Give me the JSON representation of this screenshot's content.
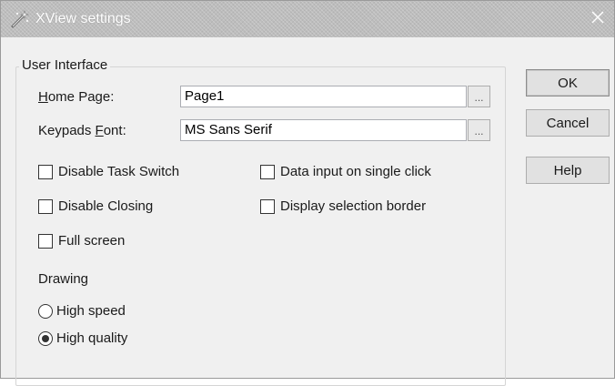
{
  "window": {
    "title": "XView settings",
    "app_icon": "settings-wand-icon",
    "close_icon": "close-icon"
  },
  "group": {
    "legend": "User Interface"
  },
  "home_page": {
    "label_mnemonic": "H",
    "label_rest": "ome Page:",
    "value": "Page1",
    "browse_label": "..."
  },
  "keypads_font": {
    "label_start": "Keypads ",
    "label_mnemonic": "F",
    "label_end": "ont:",
    "value": "MS Sans Serif",
    "browse_label": "..."
  },
  "checkboxes": {
    "disable_task_switch": {
      "label": "Disable Task Switch",
      "checked": false
    },
    "disable_closing": {
      "label": "Disable Closing",
      "checked": false
    },
    "full_screen": {
      "label": "Full screen",
      "checked": false
    },
    "data_input_single_click": {
      "label": "Data input on single click",
      "checked": false
    },
    "display_selection_border": {
      "label": "Display selection border",
      "checked": false
    }
  },
  "drawing": {
    "label": "Drawing",
    "options": [
      {
        "label": "High speed",
        "selected": false
      },
      {
        "label": "High quality",
        "selected": true
      }
    ]
  },
  "buttons": {
    "ok": "OK",
    "cancel": "Cancel",
    "help": "Help"
  },
  "colors": {
    "dialog_bg": "#f0f0f0",
    "titlebar_bg": "#bdbdbd",
    "title_text": "#ffffff"
  }
}
